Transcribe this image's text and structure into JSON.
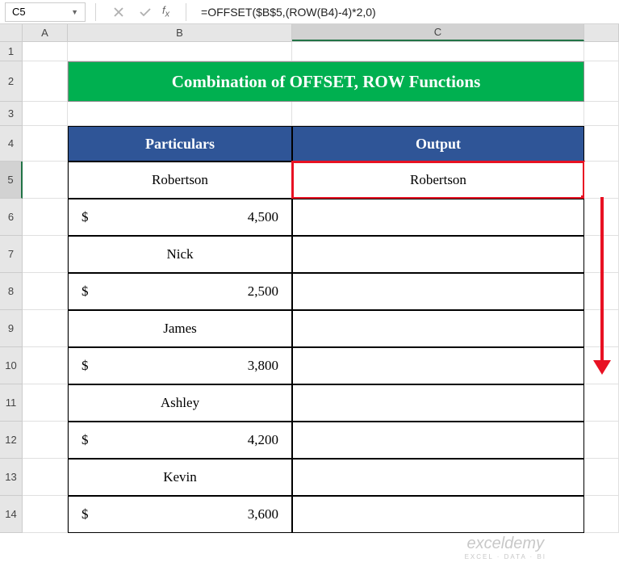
{
  "nameBox": "C5",
  "formula": "=OFFSET($B$5,(ROW(B4)-4)*2,0)",
  "columns": [
    "A",
    "B",
    "C"
  ],
  "rows": [
    "1",
    "2",
    "3",
    "4",
    "5",
    "6",
    "7",
    "8",
    "9",
    "10",
    "11",
    "12",
    "13",
    "14"
  ],
  "title": "Combination of OFFSET, ROW Functions",
  "headers": {
    "col1": "Particulars",
    "col2": "Output"
  },
  "table": {
    "r5": {
      "type": "name",
      "text": "Robertson"
    },
    "r6": {
      "type": "currency",
      "symbol": "$",
      "value": "4,500"
    },
    "r7": {
      "type": "name",
      "text": "Nick"
    },
    "r8": {
      "type": "currency",
      "symbol": "$",
      "value": "2,500"
    },
    "r9": {
      "type": "name",
      "text": "James"
    },
    "r10": {
      "type": "currency",
      "symbol": "$",
      "value": "3,800"
    },
    "r11": {
      "type": "name",
      "text": "Ashley"
    },
    "r12": {
      "type": "currency",
      "symbol": "$",
      "value": "4,200"
    },
    "r13": {
      "type": "name",
      "text": "Kevin"
    },
    "r14": {
      "type": "currency",
      "symbol": "$",
      "value": "3,600"
    }
  },
  "output": {
    "c5": "Robertson"
  },
  "watermark": {
    "line1": "exceldemy",
    "line2": "EXCEL · DATA · BI"
  }
}
